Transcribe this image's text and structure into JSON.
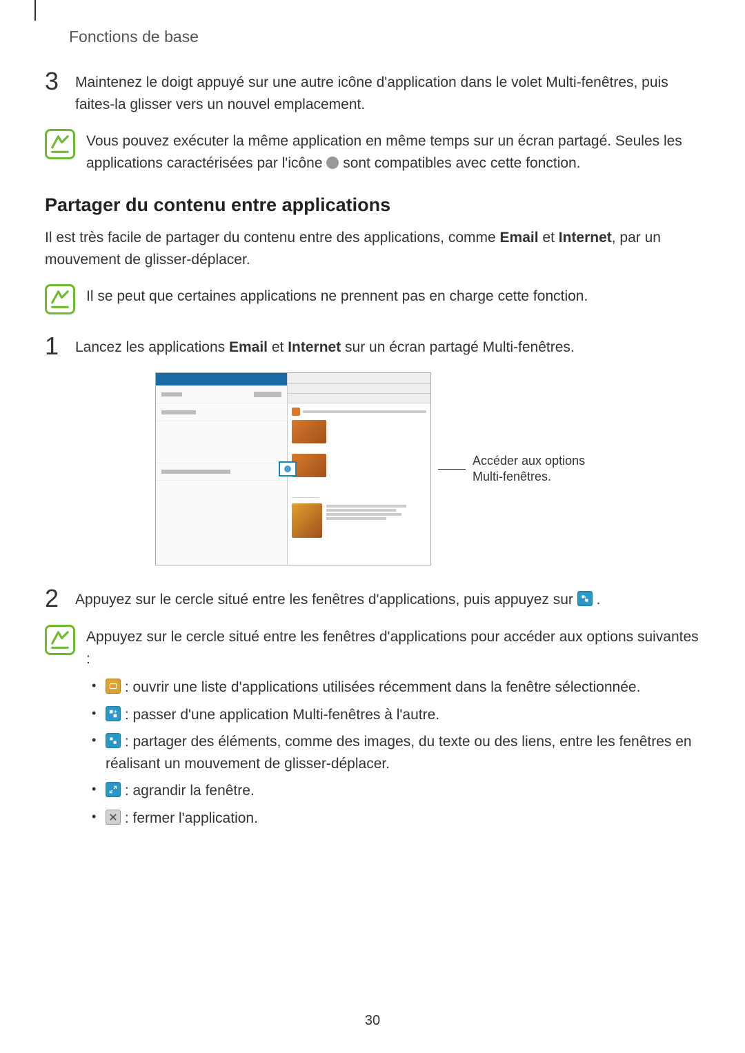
{
  "header": {
    "title": "Fonctions de base"
  },
  "step3": {
    "number": "3",
    "text": "Maintenez le doigt appuyé sur une autre icône d'application dans le volet Multi-fenêtres, puis faites-la glisser vers un nouvel emplacement."
  },
  "note1": {
    "text_a": "Vous pouvez exécuter la même application en même temps sur un écran partagé. Seules les applications caractérisées par l'icône ",
    "text_b": " sont compatibles avec cette fonction."
  },
  "section_heading": "Partager du contenu entre applications",
  "intro": {
    "a": "Il est très facile de partager du contenu entre des applications, comme ",
    "b": "Email",
    "c": " et ",
    "d": "Internet",
    "e": ", par un mouvement de glisser-déplacer."
  },
  "note2": {
    "text": "Il se peut que certaines applications ne prennent pas en charge cette fonction."
  },
  "step1": {
    "number": "1",
    "a": "Lancez les applications ",
    "b": "Email",
    "c": " et ",
    "d": "Internet",
    "e": " sur un écran partagé Multi-fenêtres."
  },
  "callout": "Accéder aux options Multi-fenêtres.",
  "step2": {
    "number": "2",
    "a": "Appuyez sur le cercle situé entre les fenêtres d'applications, puis appuyez sur ",
    "b": "."
  },
  "note3": {
    "intro": "Appuyez sur le cercle situé entre les fenêtres d'applications pour accéder aux options suivantes :",
    "items": [
      " : ouvrir une liste d'applications utilisées récemment dans la fenêtre sélectionnée.",
      " : passer d'une application Multi-fenêtres à l'autre.",
      " : partager des éléments, comme des images, du texte ou des liens, entre les fenêtres en réalisant un mouvement de glisser-déplacer.",
      " : agrandir la fenêtre.",
      " : fermer l'application."
    ]
  },
  "page_number": "30"
}
